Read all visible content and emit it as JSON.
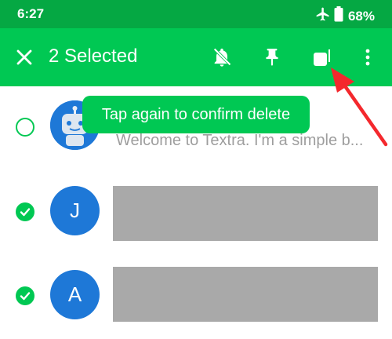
{
  "status": {
    "time": "6:27",
    "battery": "68%"
  },
  "app_bar": {
    "title": "2 Selected",
    "icons": [
      "close-icon",
      "notifications-off-icon",
      "pin-icon",
      "mark-read-icon",
      "more-vert-icon"
    ]
  },
  "toast": {
    "text": "Tap again to confirm delete"
  },
  "conversations": [
    {
      "avatar_letter": "",
      "avatar_icon": "bot-avatar-icon",
      "selected": false,
      "preview": "Welcome to Textra. I'm a simple b..."
    },
    {
      "avatar_letter": "J",
      "selected": true,
      "preview": ""
    },
    {
      "avatar_letter": "A",
      "selected": true,
      "preview": ""
    }
  ],
  "colors": {
    "status_bar": "#05a843",
    "app_bar": "#00c853",
    "accent": "#00c853",
    "avatar": "#1e78d7",
    "annotation_arrow": "#f4282d"
  }
}
